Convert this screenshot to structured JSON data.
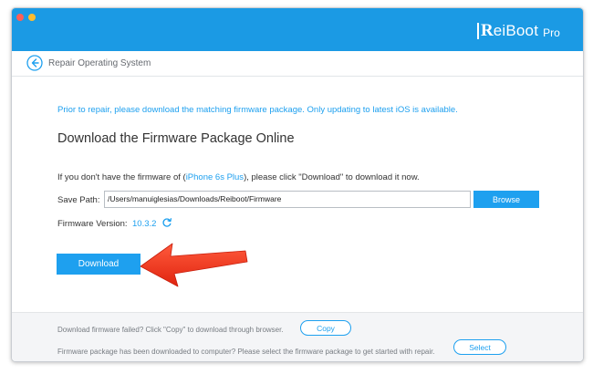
{
  "app": {
    "brand_r": "R",
    "brand_name": "eiBoot",
    "brand_suffix": "Pro"
  },
  "header": {
    "title": "Repair Operating System"
  },
  "main": {
    "notice": "Prior to repair, please download the matching firmware package. Only updating to latest iOS is available.",
    "heading": "Download the Firmware Package Online",
    "instruction_pre": "If you don't have the firmware of (",
    "device": "iPhone 6s Plus",
    "instruction_post": "), please click \"Download\" to download it now.",
    "save_path_label": "Save Path:",
    "save_path_value": "/Users/manuiglesias/Downloads/Reiboot/Firmware",
    "browse_label": "Browse",
    "firmware_label": "Firmware Version:",
    "firmware_value": "10.3.2",
    "download_label": "Download"
  },
  "footer": {
    "failed_text": "Download firmware failed? Click \"Copy\" to download through browser.",
    "copy_label": "Copy",
    "downloaded_text": "Firmware package has been downloaded to computer? Please select the firmware package to get started with repair.",
    "select_label": "Select"
  },
  "colors": {
    "titlebar": "#1b9ae4",
    "accent": "#1ea0ef",
    "arrow": "#f5331e"
  },
  "icons": {
    "back": "circle-arrow-left-icon",
    "refresh": "refresh-icon",
    "pointer": "red-arrow-icon"
  }
}
